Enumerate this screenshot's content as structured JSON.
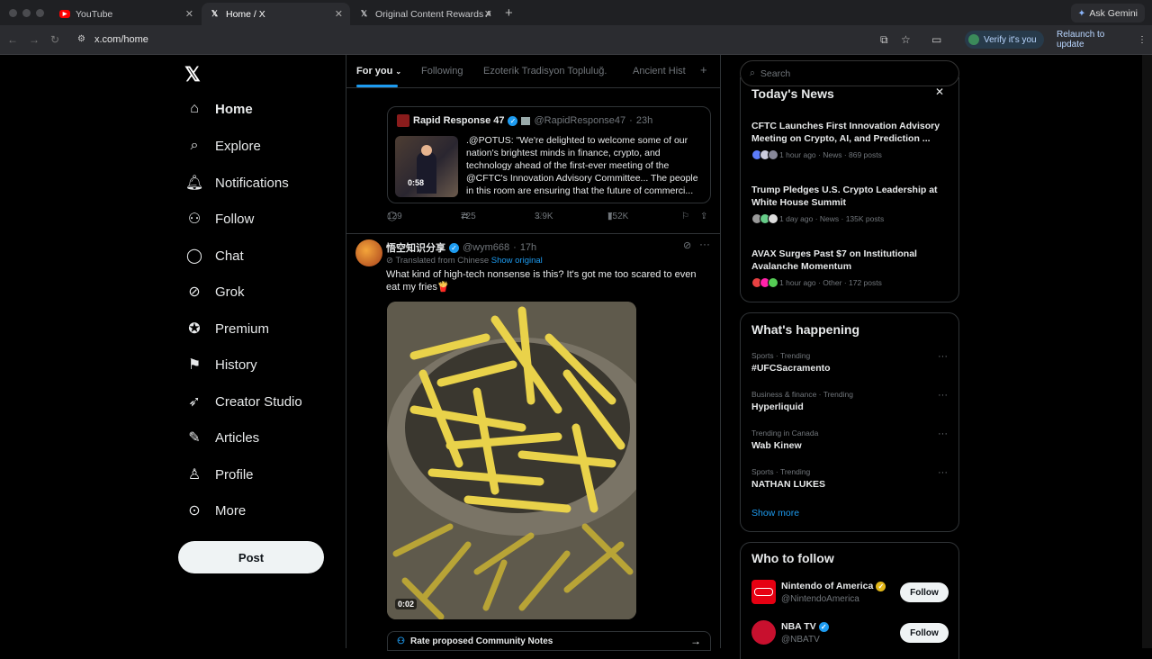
{
  "browser": {
    "tabs": [
      {
        "label": "YouTube",
        "icon": "youtube-icon"
      },
      {
        "label": "Home / X",
        "icon": "x-logo-icon"
      },
      {
        "label": "Original Content Rewards Ap",
        "icon": "x-logo-icon"
      }
    ],
    "url": "x.com/home",
    "ask_gemini": "Ask Gemini",
    "verify": "Verify it's you",
    "relaunch": "Relaunch to update"
  },
  "sidebar": {
    "items": [
      {
        "label": "Home",
        "icon": "home-icon"
      },
      {
        "label": "Explore",
        "icon": "search-icon"
      },
      {
        "label": "Notifications",
        "icon": "bell-icon"
      },
      {
        "label": "Follow",
        "icon": "follow-icon"
      },
      {
        "label": "Chat",
        "icon": "chat-icon"
      },
      {
        "label": "Grok",
        "icon": "grok-icon"
      },
      {
        "label": "Premium",
        "icon": "premium-icon"
      },
      {
        "label": "History",
        "icon": "bookmark-icon"
      },
      {
        "label": "Creator Studio",
        "icon": "rocket-icon"
      },
      {
        "label": "Articles",
        "icon": "articles-icon"
      },
      {
        "label": "Profile",
        "icon": "person-icon"
      },
      {
        "label": "More",
        "icon": "more-icon"
      }
    ],
    "post": "Post"
  },
  "feed": {
    "tabs": [
      "For you",
      "Following",
      "Ezoterik Tradisyon Topluluğ.",
      "Ancient Hist"
    ],
    "quote": {
      "name": "Rapid Response 47",
      "handle": "@RapidResponse47",
      "time": "23h",
      "duration": "0:58",
      "text": ".@POTUS: \"We're delighted to welcome some of our nation's brightest minds in finance, crypto, and technology ahead of the first-ever meeting of the @CFTC's Innovation Advisory Committee... The people in this room are ensuring that the future of commerci..."
    },
    "quote_actions": {
      "replies": "129",
      "reposts": "725",
      "likes": "3.9K",
      "views": "752K"
    },
    "post": {
      "name": "悟空知识分享",
      "handle": "@wym668",
      "time": "17h",
      "translated": "Translated from Chinese",
      "show_original": "Show original",
      "text": "What kind of high-tech nonsense is this? It's got me too scared to even eat my fries🍟",
      "duration": "0:02"
    },
    "community_notes": "Rate proposed Community Notes"
  },
  "right": {
    "search_placeholder": "Search",
    "news": {
      "title": "Today's News",
      "items": [
        {
          "title": "CFTC Launches First Innovation Advisory Meeting on Crypto, AI, and Prediction ...",
          "meta": "1 hour ago · News · 869 posts"
        },
        {
          "title": "Trump Pledges U.S. Crypto Leadership at White House Summit",
          "meta": "1 day ago · News · 135K posts"
        },
        {
          "title": "AVAX Surges Past $7 on Institutional Avalanche Momentum",
          "meta": "1 hour ago · Other · 172 posts"
        }
      ]
    },
    "happening": {
      "title": "What's happening",
      "items": [
        {
          "category": "Sports · Trending",
          "name": "#UFCSacramento"
        },
        {
          "category": "Business & finance · Trending",
          "name": "Hyperliquid"
        },
        {
          "category": "Trending in Canada",
          "name": "Wab Kinew"
        },
        {
          "category": "Sports · Trending",
          "name": "NATHAN LUKES"
        }
      ],
      "show_more": "Show more"
    },
    "who_to_follow": {
      "title": "Who to follow",
      "items": [
        {
          "name": "Nintendo of America",
          "handle": "@NintendoAmerica",
          "button": "Follow"
        },
        {
          "name": "NBA TV",
          "handle": "@NBATV",
          "button": "Follow"
        }
      ]
    }
  }
}
